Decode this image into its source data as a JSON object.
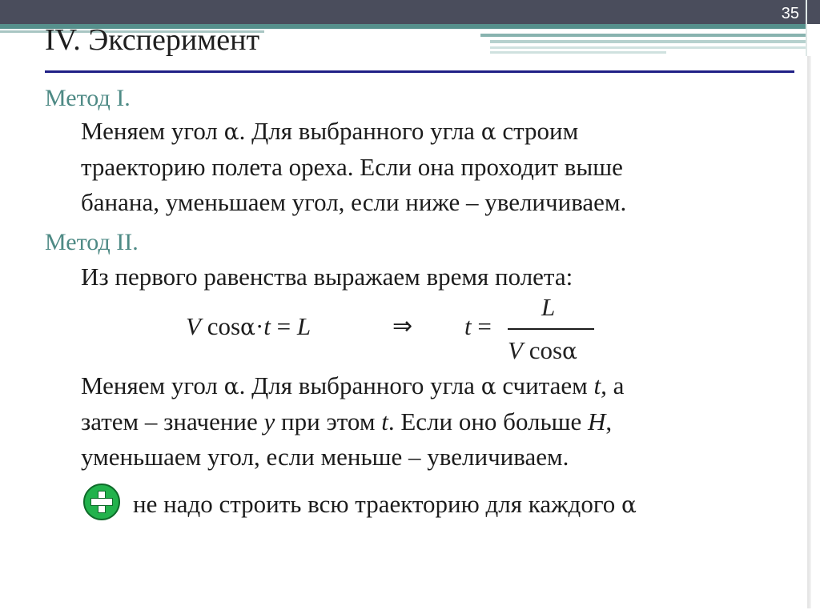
{
  "slide": {
    "page_number": "35",
    "title": "IV. Эксперимент"
  },
  "method1": {
    "heading": "Метод I.",
    "l1_a": "Меняем угол ",
    "l1_b": ". Для выбранного угла ",
    "l1_c": " строим",
    "l2": "траекторию полета ореха. Если она проходит выше",
    "l3": "банана, уменьшаем угол, если ниже – увеличиваем."
  },
  "method2": {
    "heading": "Метод II.",
    "intro": "Из первого равенства выражаем время полета:",
    "formula": {
      "lhs_v": "V",
      "lhs_cos": " cos",
      "lhs_dot": "·",
      "lhs_t": "t",
      "lhs_eq": " = ",
      "lhs_l": "L",
      "implies": "⇒",
      "rhs_t": "t",
      "rhs_eq": " = ",
      "num": "L",
      "den_v": "V",
      "den_cos": " cos"
    },
    "l1_a": "Меняем угол ",
    "l1_b": ". Для выбранного угла ",
    "l1_c": " считаем ",
    "l1_t": "t,",
    "l1_d": " а",
    "l2_a": "затем – значение  ",
    "l2_y": "y",
    "l2_b": " при этом ",
    "l2_t": "t",
    "l2_c": ". Если оно больше ",
    "l2_h": "H",
    "l2_d": ",",
    "l3": "уменьшаем угол, если меньше – увеличиваем.",
    "advantage": "не надо строить всю траекторию для каждого "
  },
  "symbols": {
    "alpha": "α"
  },
  "icons": {
    "advantage_icon": "plus-circle-icon"
  },
  "colors": {
    "accent": "#4e8a85",
    "rule": "#1f1f86",
    "header": "#4a4d5c",
    "plus": "#22b24c"
  }
}
